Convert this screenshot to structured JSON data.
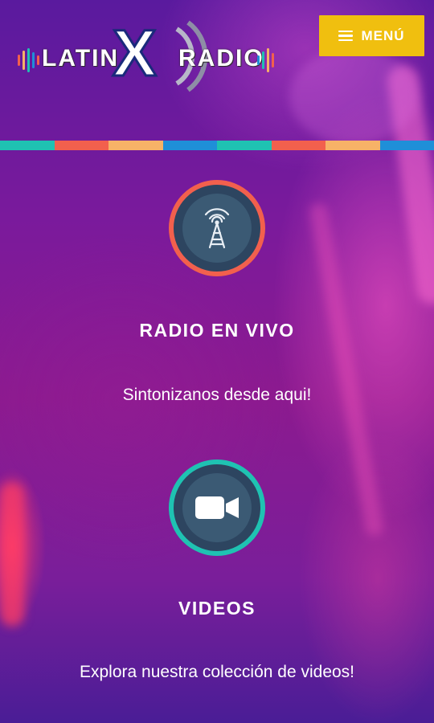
{
  "header": {
    "logo": {
      "word_left": "LATIN",
      "word_x": "X",
      "word_right": "RADIO"
    },
    "menu_label": "MENÚ"
  },
  "colors": {
    "menu_button": "#f0bf0f",
    "radio_ring": "#f2604d",
    "video_ring": "#1fc2b2",
    "icon_bg": "#3b5a74",
    "stripe": [
      "#1fc2b2",
      "#f2604d",
      "#f7b267",
      "#1f8fd8",
      "#1fc2b2",
      "#f2604d",
      "#f7b267",
      "#1f8fd8"
    ]
  },
  "sections": [
    {
      "icon": "radio-tower-icon",
      "title": "RADIO EN VIVO",
      "subtitle": "Sintonizanos desde aqui!"
    },
    {
      "icon": "video-camera-icon",
      "title": "VIDEOS",
      "subtitle": "Explora nuestra colección de videos!"
    }
  ]
}
